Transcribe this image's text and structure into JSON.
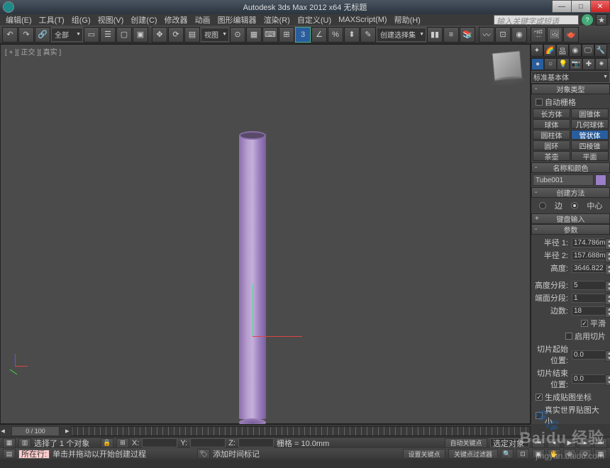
{
  "title": "Autodesk 3ds Max  2012 x64     无标题",
  "menus": [
    "编辑(E)",
    "工具(T)",
    "组(G)",
    "视图(V)",
    "创建(C)",
    "修改器",
    "动画",
    "图形编辑器",
    "渲染(R)",
    "自定义(U)",
    "MAXScript(M)",
    "帮助(H)"
  ],
  "search_placeholder": "输入关键字或短语",
  "toolbar_dropdown1": "全部",
  "toolbar_dropdown2": "视图",
  "toolbar_dropdown3": "创建选择集",
  "vp_label": "[ + ][ 正交 ][ 真实 ]",
  "right": {
    "category": "标准基本体",
    "section_objtype": "对象类型",
    "autogrid": "自动栅格",
    "objects": [
      "长方体",
      "圆锥体",
      "球体",
      "几何球体",
      "圆柱体",
      "管状体",
      "圆环",
      "四棱锥",
      "茶壶",
      "平面"
    ],
    "section_namecolor": "名称和颜色",
    "objname": "Tube001",
    "section_method": "创建方法",
    "opt_edge": "边",
    "opt_center": "中心",
    "section_keyboard": "键盘输入",
    "section_params": "参数",
    "r1_label": "半径 1:",
    "r1": "174.786m",
    "r2_label": "半径 2:",
    "r2": "157.688m",
    "h_label": "高度:",
    "h": "3646.822",
    "hseg_label": "高度分段:",
    "hseg": "5",
    "cseg_label": "端面分段:",
    "cseg": "1",
    "sides_label": "边数:",
    "sides": "18",
    "smooth": "平滑",
    "slice_on": "启用切片",
    "sfrom_label": "切片起始位置:",
    "sfrom": "0.0",
    "sto_label": "切片结束位置:",
    "sto": "0.0",
    "genmap": "生成贴图坐标",
    "realworld": "真实世界贴图大小"
  },
  "timeline_value": "0 / 100",
  "status1": {
    "selected": "选择了 1 个对象",
    "x_label": "X:",
    "y_label": "Y:",
    "z_label": "Z:",
    "grid_label": "栅格 = 10.0mm",
    "autokey": "自动关键点",
    "selected_obj": "选定对象"
  },
  "status2": {
    "current_label": "所在行:",
    "hint": "单击并拖动以开始创建过程",
    "addtime": "添加时间标记",
    "setkey": "设置关键点",
    "keyfilter": "关键点过滤器"
  },
  "watermark": "Baidu 经验",
  "watermark_url": "jingyan.baidu.com"
}
